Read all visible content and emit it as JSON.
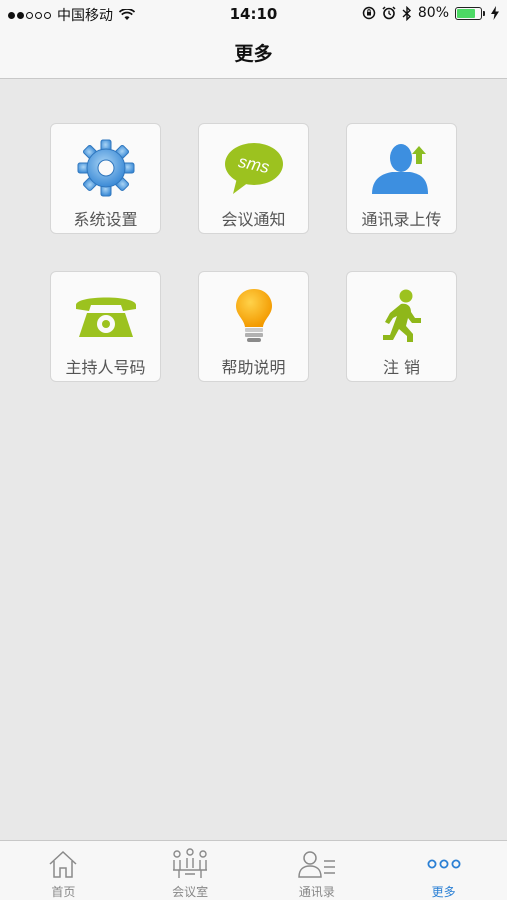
{
  "status_bar": {
    "carrier": "中国移动",
    "time": "14:10",
    "battery": "80%",
    "battery_level": 0.8
  },
  "nav": {
    "title": "更多"
  },
  "tiles": [
    {
      "label": "系统设置",
      "icon": "gear-icon"
    },
    {
      "label": "会议通知",
      "icon": "sms-bubble-icon"
    },
    {
      "label": "通讯录上传",
      "icon": "contact-upload-icon"
    },
    {
      "label": "主持人号码",
      "icon": "phone-icon"
    },
    {
      "label": "帮助说明",
      "icon": "lightbulb-icon"
    },
    {
      "label": "注 销",
      "icon": "running-man-icon"
    }
  ],
  "tabbar": {
    "items": [
      {
        "label": "首页",
        "icon": "home-icon"
      },
      {
        "label": "会议室",
        "icon": "meeting-room-icon"
      },
      {
        "label": "通讯录",
        "icon": "contacts-icon"
      },
      {
        "label": "更多",
        "icon": "more-dots-icon"
      }
    ],
    "active": "更多"
  },
  "colors": {
    "accent": "#2a7fd4",
    "green": "#9cc21f",
    "battery": "#4cd964",
    "background": "#e8e8e8"
  },
  "icons": {
    "sms_text": "sms"
  }
}
